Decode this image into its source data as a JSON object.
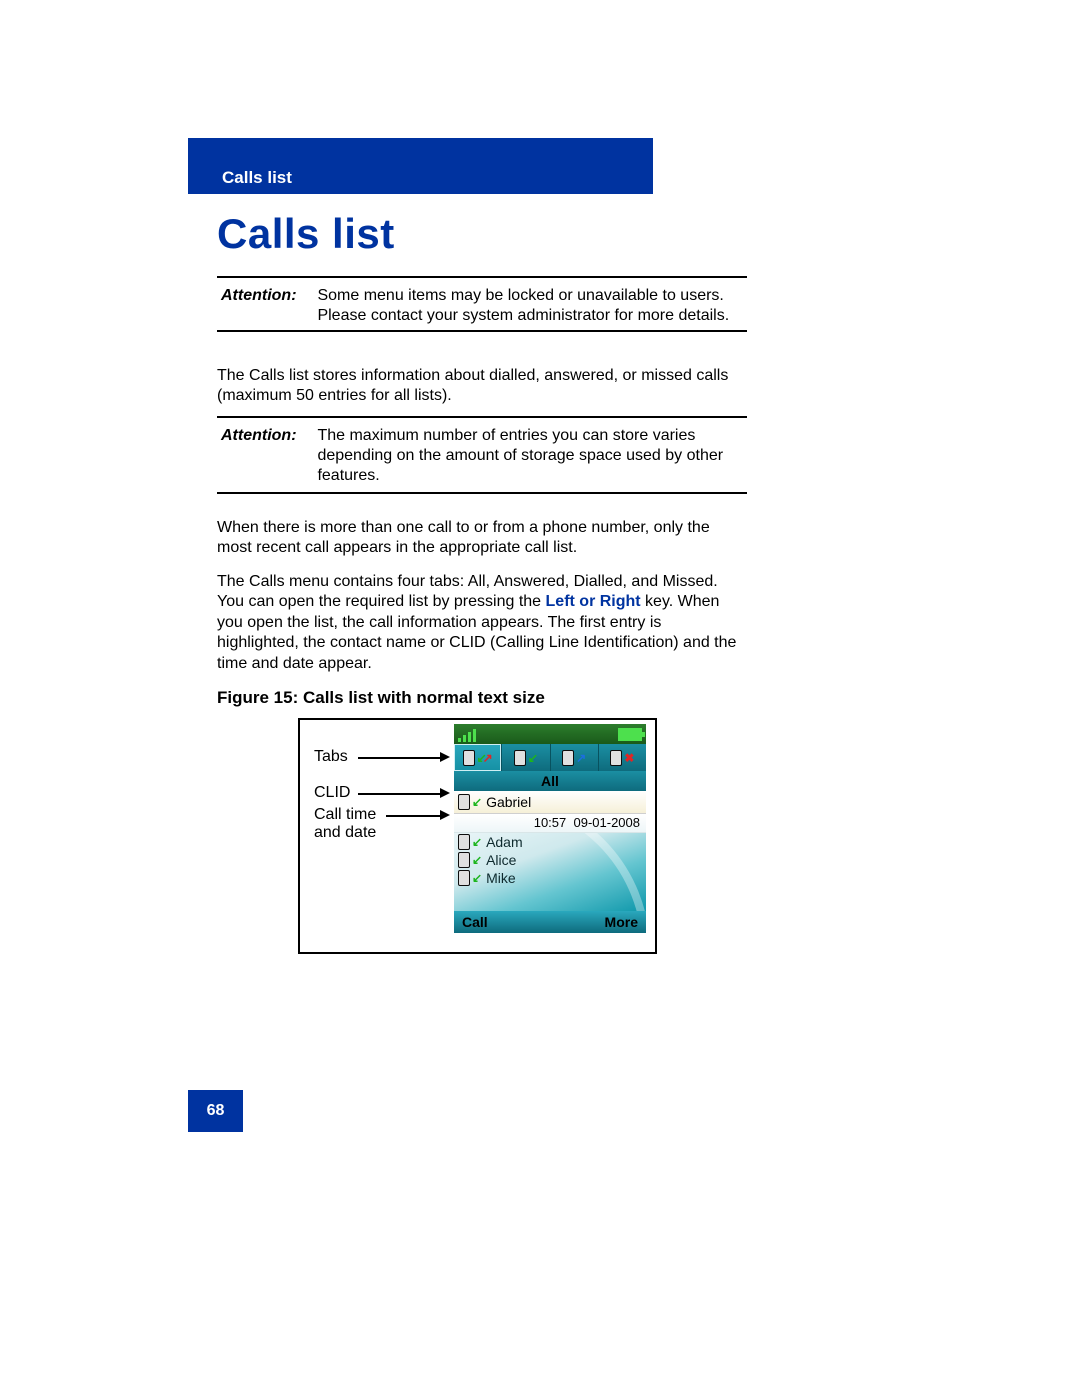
{
  "header": {
    "running_title": "Calls list"
  },
  "chapter_title": "Calls list",
  "attention1": {
    "label": "Attention:",
    "text": "Some menu items may be locked or unavailable to users. Please contact your system administrator for more details."
  },
  "para1": "The Calls list stores information about dialled, answered, or missed calls (maximum 50 entries for all lists).",
  "attention2": {
    "label": "Attention:",
    "text": "The maximum number of entries you can store varies depending on the amount of storage space used by other features."
  },
  "para2": "When there is more than one call to or from a phone number, only the most recent call appears in the appropriate call list.",
  "para3_a": "The Calls menu contains four tabs: All, Answered, Dialled, and Missed. You can open the required list by pressing the ",
  "para3_kw": "Left or Right",
  "para3_b": " key. When you open the list, the call information appears. The first entry is highlighted, the contact name or CLID (Calling Line Identification) and the time and date appear.",
  "figure": {
    "caption": "Figure 15: Calls list with normal text size",
    "labels": {
      "tabs": "Tabs",
      "clid": "CLID",
      "calltime": "Call time and date"
    },
    "phone": {
      "tab_title": "All",
      "selected": {
        "name": "Gabriel",
        "time": "10:57",
        "date": "09-01-2008"
      },
      "rows": [
        "Adam",
        "Alice",
        "Mike"
      ],
      "softkeys": {
        "left": "Call",
        "right": "More"
      }
    }
  },
  "page_number": "68"
}
